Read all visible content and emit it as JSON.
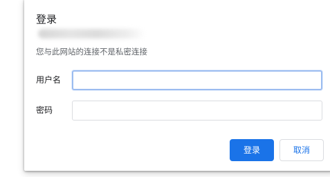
{
  "dialog": {
    "title": "登录",
    "warning": "您与此网站的连接不是私密连接",
    "fields": {
      "username_label": "用户名",
      "username_value": "",
      "password_label": "密码",
      "password_value": ""
    },
    "buttons": {
      "login_label": "登录",
      "cancel_label": "取消"
    }
  },
  "colors": {
    "accent": "#1a73e8",
    "focus_ring": "#9bbcf0",
    "border": "#dadce0",
    "secondary_text": "#5f6368"
  }
}
